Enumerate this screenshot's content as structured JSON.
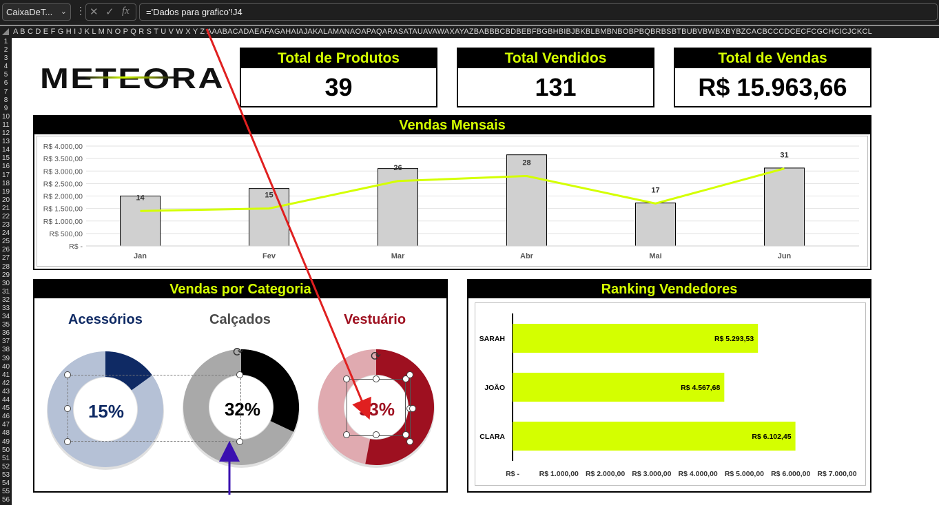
{
  "formula_bar": {
    "name_box": "CaixaDeT...",
    "formula": "='Dados para grafico'!J4"
  },
  "column_headers": "A B C D E F G H I J K L M N O P Q R S T U V W X Y Z AAABACADAEAFAGAHAIAJAKALAMANAOAPAQARASATAUAVAWAXAYAZBABBBCBDBEBFBGBHBIBJBKBLBMBNBOBPBQBRBSBTBUBVBWBXBYBZCACBCCCDCECFCGCHCICJCKCL",
  "logo": {
    "text": "METEORA"
  },
  "kpis": [
    {
      "title": "Total de Produtos",
      "value": "39"
    },
    {
      "title": "Total Vendidos",
      "value": "131"
    },
    {
      "title": "Total de Vendas",
      "value": "R$ 15.963,66"
    }
  ],
  "colors": {
    "accent": "#D4FF00",
    "navy": "#0F2A64",
    "maroon": "#9E1020",
    "bar_gray": "#D0D0D0"
  },
  "monthly": {
    "title": "Vendas Mensais",
    "y_ticks": [
      "R$ 4.000,00",
      "R$ 3.500,00",
      "R$ 3.000,00",
      "R$ 2.500,00",
      "R$ 2.000,00",
      "R$ 1.500,00",
      "R$ 1.000,00",
      "R$ 500,00",
      "R$ -"
    ]
  },
  "category": {
    "title": "Vendas por Categoria",
    "items": [
      {
        "name": "Acessórios",
        "pct_label": "15%",
        "pct": 15
      },
      {
        "name": "Calçados",
        "pct_label": "32%",
        "pct": 32
      },
      {
        "name": "Vestuário",
        "pct_label": "53%",
        "pct": 53
      }
    ]
  },
  "ranking": {
    "title": "Ranking Vendedores",
    "x_ticks": [
      "R$ -",
      "R$ 1.000,00",
      "R$ 2.000,00",
      "R$ 3.000,00",
      "R$ 4.000,00",
      "R$ 5.000,00",
      "R$ 6.000,00",
      "R$ 7.000,00"
    ]
  },
  "chart_data": [
    {
      "type": "bar",
      "title": "Vendas Mensais",
      "categories": [
        "Jan",
        "Fev",
        "Mar",
        "Abr",
        "Mai",
        "Jun"
      ],
      "series": [
        {
          "values": [
            2000,
            2300,
            3100,
            3650,
            1720,
            3120
          ]
        },
        {
          "values": [
            14,
            15,
            26,
            28,
            17,
            31
          ]
        }
      ],
      "line_data_labels": [
        "14",
        "15",
        "26",
        "28",
        "17",
        "31"
      ],
      "ylim": [
        0,
        4000
      ]
    },
    {
      "type": "bar",
      "title": "Ranking Vendedores",
      "categories": [
        "SARAH",
        "JOÃO",
        "CLARA"
      ],
      "values": [
        5293.53,
        4567.68,
        6102.45
      ],
      "value_labels": [
        "R$ 5.293,53",
        "R$ 4.567,68",
        "R$ 6.102,45"
      ],
      "xlim": [
        0,
        7000
      ]
    }
  ]
}
